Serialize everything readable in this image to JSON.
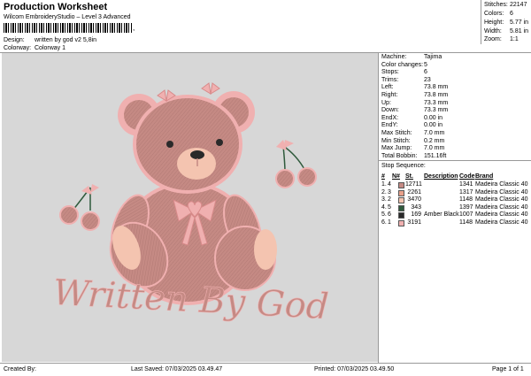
{
  "header": {
    "title": "Production Worksheet",
    "subtitle": "Wilcom EmbroideryStudio – Level 3 Advanced",
    "barcode_suffix": ","
  },
  "design_info": {
    "design_label": "Design:",
    "design_value": "written by god v2 5,8in",
    "colorway_label": "Colorway:",
    "colorway_value": "Colorway 1"
  },
  "summary": {
    "stitches_label": "Stitches:",
    "stitches": "22147",
    "colors_label": "Colors:",
    "colors": "6",
    "height_label": "Height:",
    "height": "5.77 in",
    "width_label": "Width:",
    "width": "5.81 in",
    "zoom_label": "Zoom:",
    "zoom": "1:1"
  },
  "machine": [
    {
      "label": "Machine:",
      "value": "Tajima"
    },
    {
      "label": "Color changes:",
      "value": "5"
    },
    {
      "label": "Stops:",
      "value": "6"
    },
    {
      "label": "Trims:",
      "value": "23"
    },
    {
      "label": "Left:",
      "value": "73.8 mm"
    },
    {
      "label": "Right:",
      "value": "73.8 mm"
    },
    {
      "label": "Up:",
      "value": "73.3 mm"
    },
    {
      "label": "Down:",
      "value": "73.3 mm"
    },
    {
      "label": "EndX:",
      "value": "0.00 in"
    },
    {
      "label": "EndY:",
      "value": "0.00 in"
    },
    {
      "label": "Max Stitch:",
      "value": "7.0 mm"
    },
    {
      "label": "Min Stitch:",
      "value": "0.2 mm"
    },
    {
      "label": "Max Jump:",
      "value": "7.0 mm"
    },
    {
      "label": "Total Bobbin:",
      "value": "151.16ft"
    }
  ],
  "stop_sequence": {
    "title": "Stop Sequence:",
    "headers": {
      "num": "#",
      "n": "N#",
      "st": "St.",
      "desc": "Description",
      "code": "Code",
      "brand": "Brand"
    },
    "rows": [
      {
        "num": "1.",
        "n": "4",
        "color": "#c58a84",
        "st": "12711",
        "desc": "",
        "code": "1341",
        "brand": "Madeira Classic 40"
      },
      {
        "num": "2.",
        "n": "3",
        "color": "#e8a08a",
        "st": "2261",
        "desc": "",
        "code": "1317",
        "brand": "Madeira Classic 40"
      },
      {
        "num": "3.",
        "n": "2",
        "color": "#f4c4b0",
        "st": "3470",
        "desc": "",
        "code": "1148",
        "brand": "Madeira Classic 40"
      },
      {
        "num": "4.",
        "n": "5",
        "color": "#2f5a3c",
        "st": "343",
        "desc": "",
        "code": "1397",
        "brand": "Madeira Classic 40"
      },
      {
        "num": "5.",
        "n": "6",
        "color": "#2a2a2a",
        "st": "169",
        "desc": "Amber Black",
        "code": "1007",
        "brand": "Madeira Classic 40"
      },
      {
        "num": "6.",
        "n": "1",
        "color": "#f0b0b0",
        "st": "3191",
        "desc": "",
        "code": "1148",
        "brand": "Madeira Classic 40"
      }
    ]
  },
  "artwork": {
    "text": "Written By God",
    "body_color": "#c58a84",
    "light_color": "#f4c4b0",
    "pink_color": "#f0b0b0",
    "leaf_color": "#2f5a3c",
    "dark_color": "#2a2a2a"
  },
  "footer": {
    "created_by": "Created By:",
    "last_saved": "Last Saved: 07/03/2025 03.49.47",
    "printed": "Printed: 07/03/2025 03.49.50",
    "page": "Page 1 of 1"
  }
}
